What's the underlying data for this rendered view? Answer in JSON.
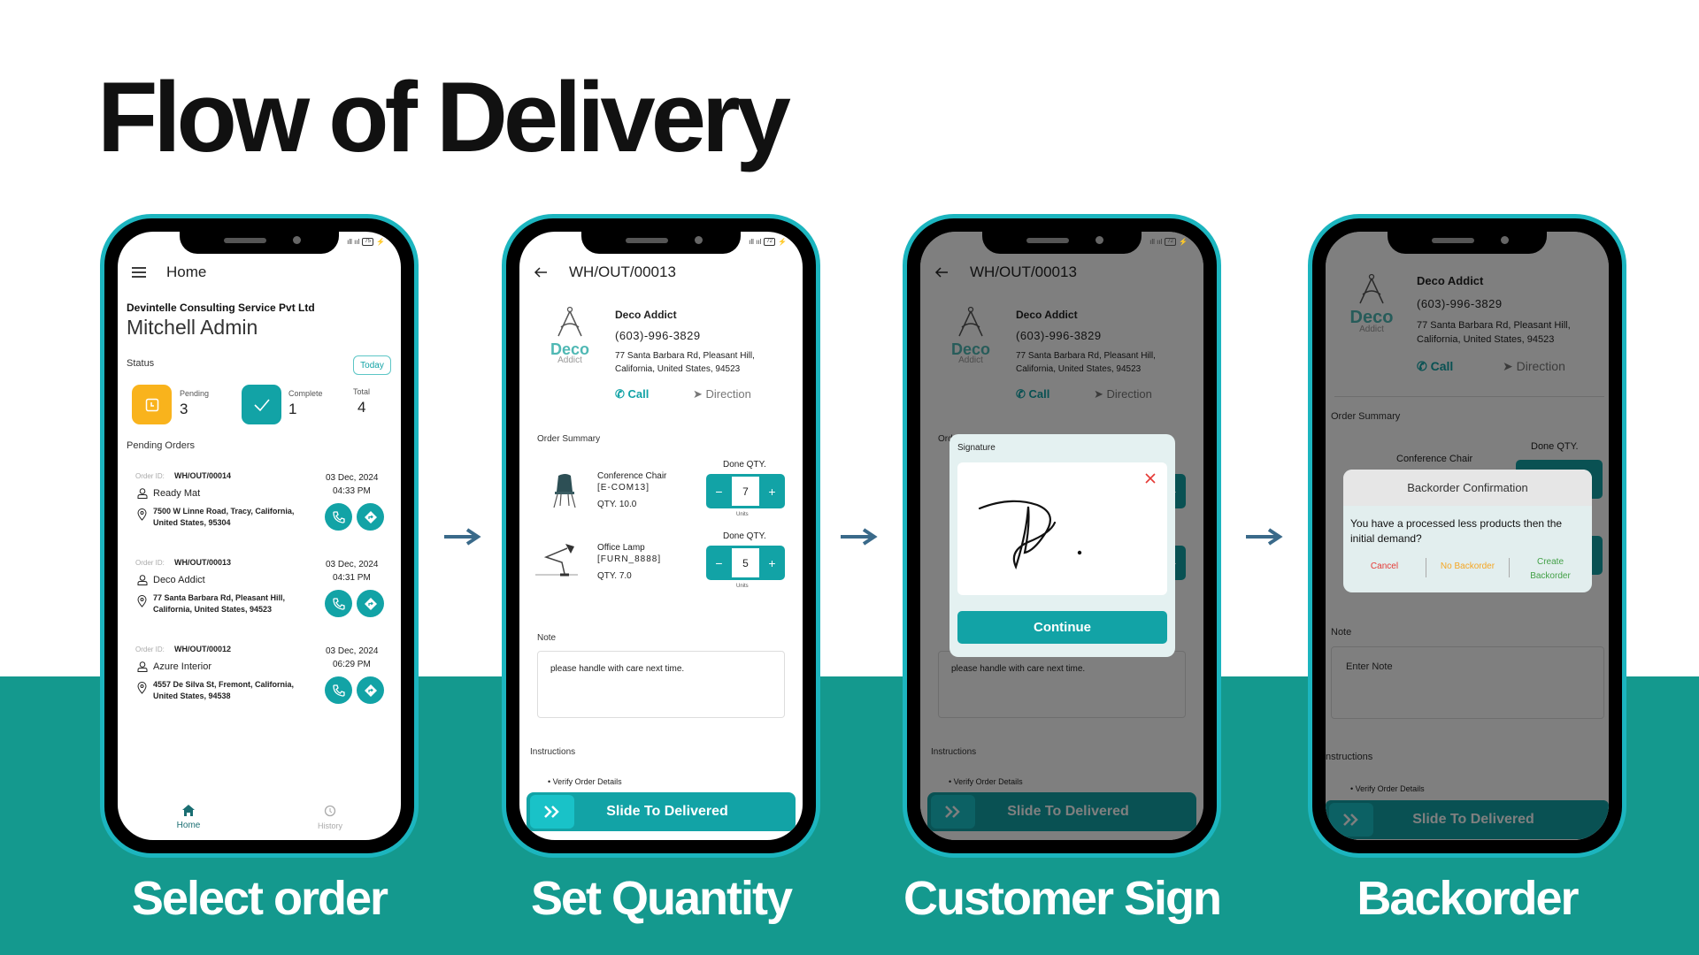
{
  "title": "Flow of Delivery",
  "colors": {
    "accent": "#12a3a6",
    "band": "#14998e",
    "pending": "#f9b31c",
    "cancel": "#e53935",
    "no_backorder": "#f5a623",
    "create_backorder": "#43a047"
  },
  "captions": [
    "Select order",
    "Set Quantity",
    "Customer Sign",
    "Backorder"
  ],
  "home": {
    "battery": "75",
    "header_title": "Home",
    "company": "Devintelle Consulting Service Pvt Ltd",
    "user": "Mitchell Admin",
    "status_label": "Status",
    "filter_button": "Today",
    "pending_label": "Pending",
    "pending_count": "3",
    "complete_label": "Complete",
    "complete_count": "1",
    "total_label": "Total",
    "total_count": "4",
    "pending_orders_label": "Pending Orders",
    "order_id_label": "Order ID:",
    "orders": [
      {
        "id": "WH/OUT/00014",
        "customer": "Ready Mat",
        "address1": "7500 W Linne Road, Tracy, California,",
        "address2": "United States, 95304",
        "date": "03 Dec, 2024",
        "time": "04:33 PM"
      },
      {
        "id": "WH/OUT/00013",
        "customer": "Deco Addict",
        "address1": "77 Santa Barbara Rd, Pleasant Hill,",
        "address2": "California, United States, 94523",
        "date": "03 Dec, 2024",
        "time": "04:31 PM"
      },
      {
        "id": "WH/OUT/00012",
        "customer": "Azure Interior",
        "address1": "4557 De Silva St, Fremont, California,",
        "address2": "United States, 94538",
        "date": "03 Dec, 2024",
        "time": "06:29 PM"
      }
    ],
    "nav": [
      {
        "label": "Home",
        "icon": "home-icon",
        "active": true
      },
      {
        "label": "History",
        "icon": "history-icon",
        "active": false
      }
    ]
  },
  "order": {
    "battery": "72",
    "title": "WH/OUT/00013",
    "logo_word": "Deco",
    "logo_sub": "Addict",
    "customer": "Deco Addict",
    "phone": "(603)-996-3829",
    "address1": "77 Santa Barbara Rd, Pleasant Hill,",
    "address2": "California, United States, 94523",
    "call": "Call",
    "direction": "Direction",
    "summary_label": "Order Summary",
    "done_qty_label": "Done QTY.",
    "units_label": "Units",
    "items": [
      {
        "name": "Conference Chair",
        "code": "[E-COM13]",
        "qty": "QTY. 10.0",
        "done": "7"
      },
      {
        "name": "Office Lamp",
        "code": "[FURN_8888]",
        "qty": "QTY. 7.0",
        "done": "5"
      }
    ],
    "note_label": "Note",
    "note_value": "please handle with care next time.",
    "note_placeholder": "Enter Note",
    "instructions_label": "Instructions",
    "instructions_partial": "nstructions",
    "instruction_item": "• Verify Order Details",
    "slide_label": "Slide To Delivered"
  },
  "signature_dialog": {
    "label": "Signature",
    "continue": "Continue"
  },
  "backorder_dialog": {
    "title": "Backorder Confirmation",
    "message": "You have a processed less products then the initial demand?",
    "cancel": "Cancel",
    "no_backorder": "No Backorder",
    "create_backorder": "Create Backorder"
  }
}
